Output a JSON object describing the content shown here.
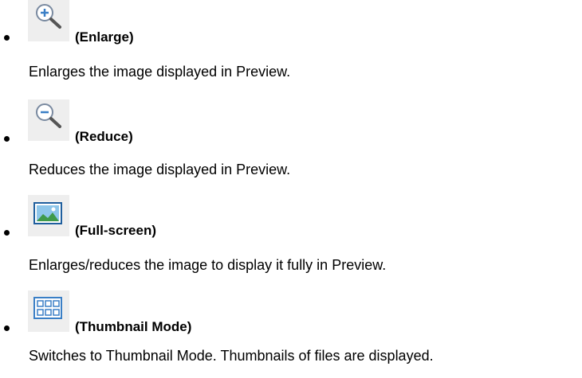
{
  "items": [
    {
      "icon": "zoom-in-icon",
      "label": "(Enlarge)",
      "description": "Enlarges the image displayed in Preview."
    },
    {
      "icon": "zoom-out-icon",
      "label": "(Reduce)",
      "description": "Reduces the image displayed in Preview."
    },
    {
      "icon": "full-screen-icon",
      "label": "(Full-screen)",
      "description": "Enlarges/reduces the image to display it fully in Preview."
    },
    {
      "icon": "thumbnail-mode-icon",
      "label": "(Thumbnail Mode)",
      "description": "Switches to Thumbnail Mode. Thumbnails of files are displayed."
    }
  ],
  "colors": {
    "icon_background": "#eeeeee",
    "icon_accent": "#3a7fc6"
  }
}
